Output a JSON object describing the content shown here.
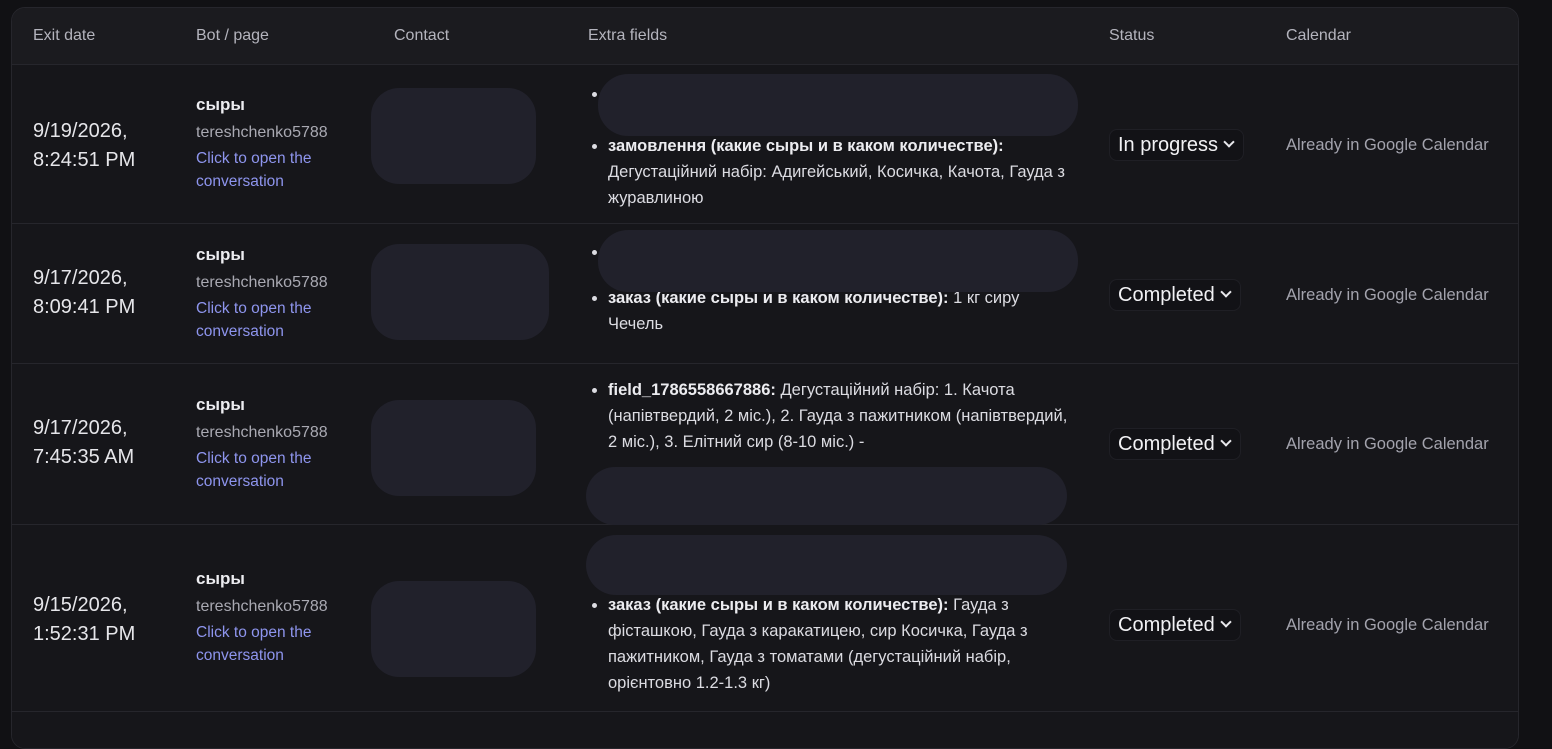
{
  "table": {
    "columns": {
      "exit_date": "Exit date",
      "bot_page": "Bot / page",
      "contact": "Contact",
      "extra_fields": "Extra fields",
      "status": "Status",
      "calendar": "Calendar"
    },
    "rows": [
      {
        "date_line1": "9/19/2026,",
        "date_line2": "8:24:51 PM",
        "bot_name": "сыры",
        "bot_user": "tereshchenko5788",
        "link": "Click to open the conversation",
        "field_key": "замовлення (какие сыры и в каком количестве):",
        "field_value": " Дегустаційний набір: Адигейський, Косичка, Качота, Гауда з журавлиною",
        "status": "In progress",
        "calendar": "Already in Google Calendar"
      },
      {
        "date_line1": "9/17/2026,",
        "date_line2": "8:09:41 PM",
        "bot_name": "сыры",
        "bot_user": "tereshchenko5788",
        "link": "Click to open the conversation",
        "field_key": "заказ (какие сыры и в каком количестве):",
        "field_value": " 1 кг сиру Чечель",
        "status": "Completed",
        "calendar": "Already in Google Calendar"
      },
      {
        "date_line1": "9/17/2026,",
        "date_line2": "7:45:35 AM",
        "bot_name": "сыры",
        "bot_user": "tereshchenko5788",
        "link": "Click to open the conversation",
        "field_key": "field_1786558667886:",
        "field_value": " Дегустаційний набір: 1. Качота (напівтвердий, 2 міс.), 2. Гауда з пажитником (напівтвердий, 2 міс.), 3. Елітний сир (8-10 міс.) -",
        "status": "Completed",
        "calendar": "Already in Google Calendar"
      },
      {
        "date_line1": "9/15/2026,",
        "date_line2": "1:52:31 PM",
        "bot_name": "сыры",
        "bot_user": "tereshchenko5788",
        "link": "Click to open the conversation",
        "field_key": "заказ (какие сыры и в каком количестве):",
        "field_value": " Гауда з фісташкою, Гауда з каракатицею, сир Косичка, Гауда з пажитником, Гауда з томатами (дегустаційний набір, орієнтовно 1.2-1.3 кг)",
        "status": "Completed",
        "calendar": "Already in Google Calendar"
      }
    ]
  }
}
